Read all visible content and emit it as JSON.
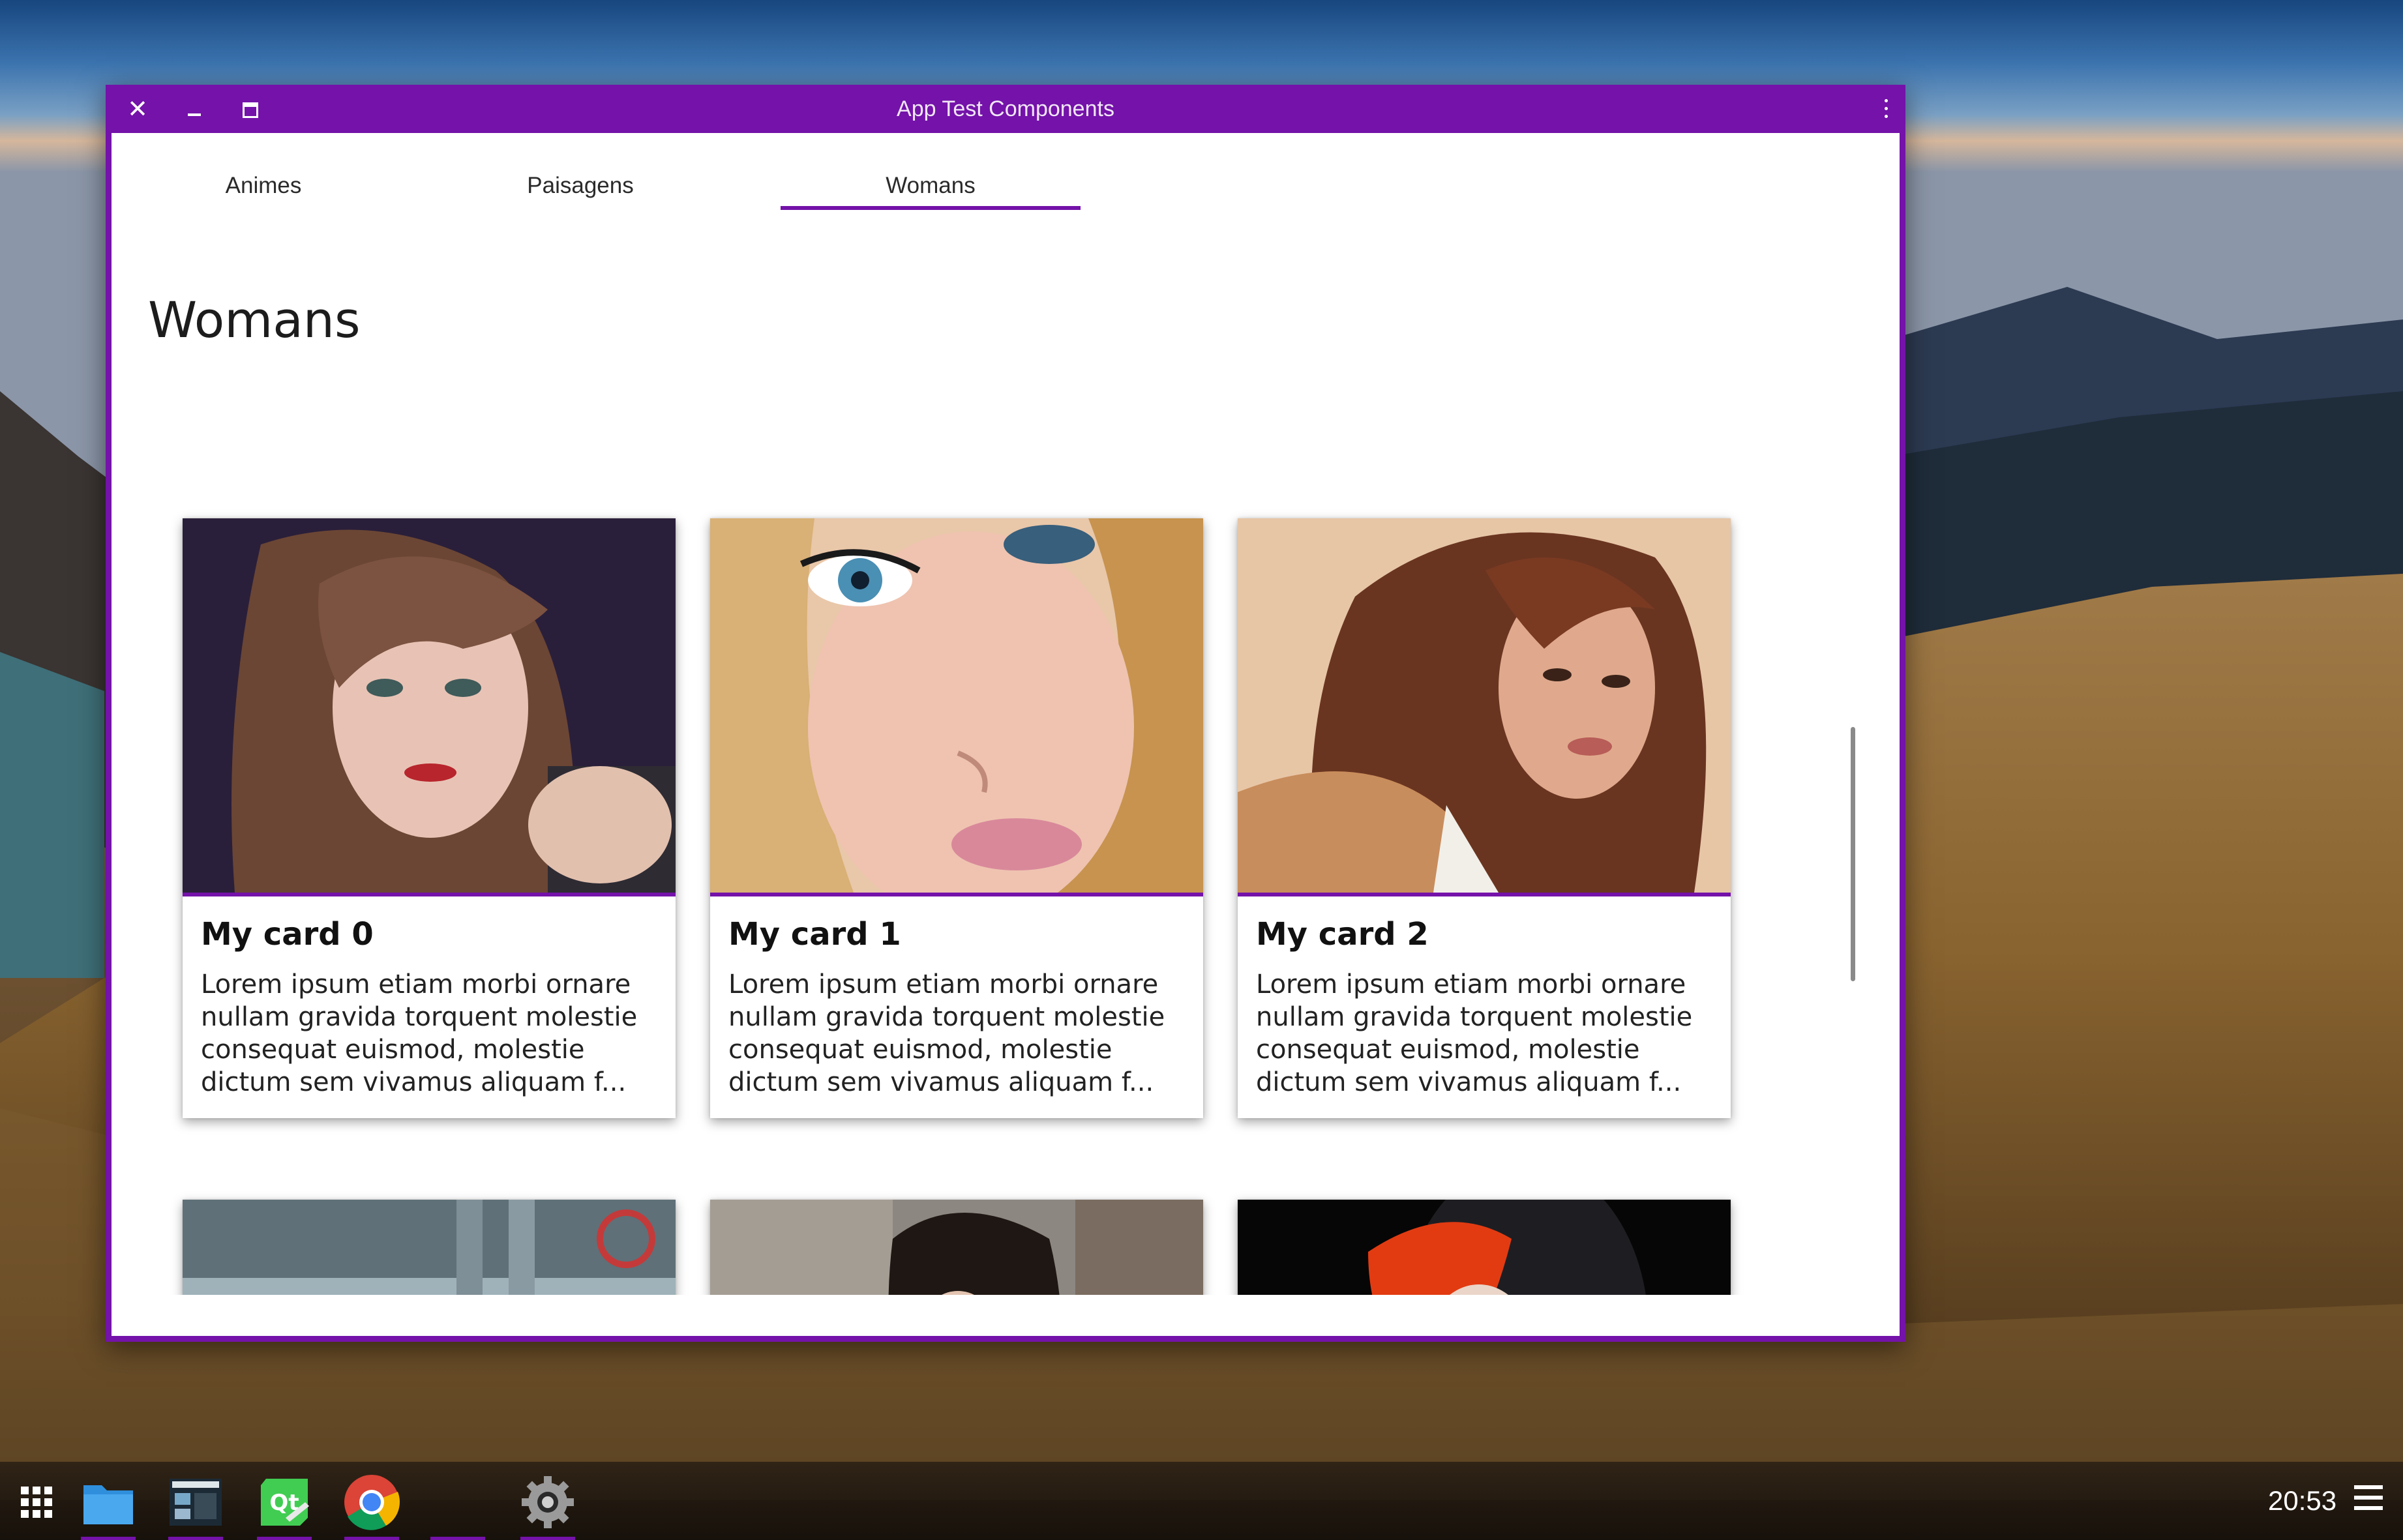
{
  "window": {
    "title": "App Test Components"
  },
  "tabs": [
    {
      "label": "Animes"
    },
    {
      "label": "Paisagens"
    },
    {
      "label": "Womans"
    }
  ],
  "active_tab": "Womans",
  "page": {
    "heading": "Womans"
  },
  "cards": [
    {
      "title": "My card 0",
      "text": "Lorem ipsum etiam morbi ornare nullam gravida torquent molestie consequat euismod, molestie dictum sem vivamus aliquam f..."
    },
    {
      "title": "My card 1",
      "text": "Lorem ipsum etiam morbi ornare nullam gravida torquent molestie consequat euismod, molestie dictum sem vivamus aliquam f..."
    },
    {
      "title": "My card 2",
      "text": "Lorem ipsum etiam morbi ornare nullam gravida torquent molestie consequat euismod, molestie dictum sem vivamus aliquam f..."
    }
  ],
  "taskbar": {
    "items": [
      "app-grid-icon",
      "files-icon",
      "screenshot-app-icon",
      "qt-creator-icon",
      "chrome-icon",
      "settings-icon"
    ],
    "clock": "20:53"
  },
  "colors": {
    "accent": "#7412a9",
    "window_bg": "#ffffff"
  }
}
